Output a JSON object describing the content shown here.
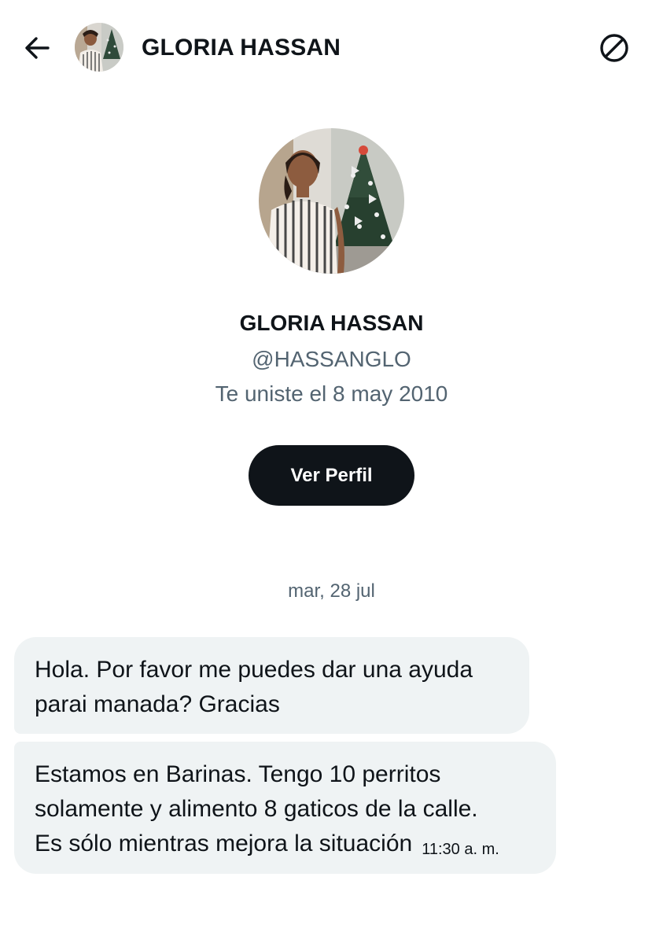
{
  "header": {
    "back_icon": "arrow-left-icon",
    "name": "GLORIA HASSAN",
    "block_icon": "block-icon"
  },
  "profile": {
    "name": "GLORIA HASSAN",
    "handle": "@HASSANGLO",
    "joined": "Te uniste el 8 may 2010",
    "view_profile_label": "Ver Perfil"
  },
  "conversation": {
    "date": "mar, 28 jul",
    "messages": [
      {
        "lines": [
          "Hola. Por favor me puedes dar una ayuda",
          "parai manada? Gracias"
        ]
      },
      {
        "lines": [
          "Estamos en Barinas. Tengo 10 perritos",
          "solamente y alimento 8 gaticos de la calle.",
          "Es sólo mientras mejora la situación"
        ],
        "time": "11:30 a. m."
      }
    ]
  },
  "colors": {
    "text_primary": "#0f1419",
    "text_secondary": "#536471",
    "bubble_bg": "#eff3f4",
    "button_bg": "#0f1419"
  }
}
